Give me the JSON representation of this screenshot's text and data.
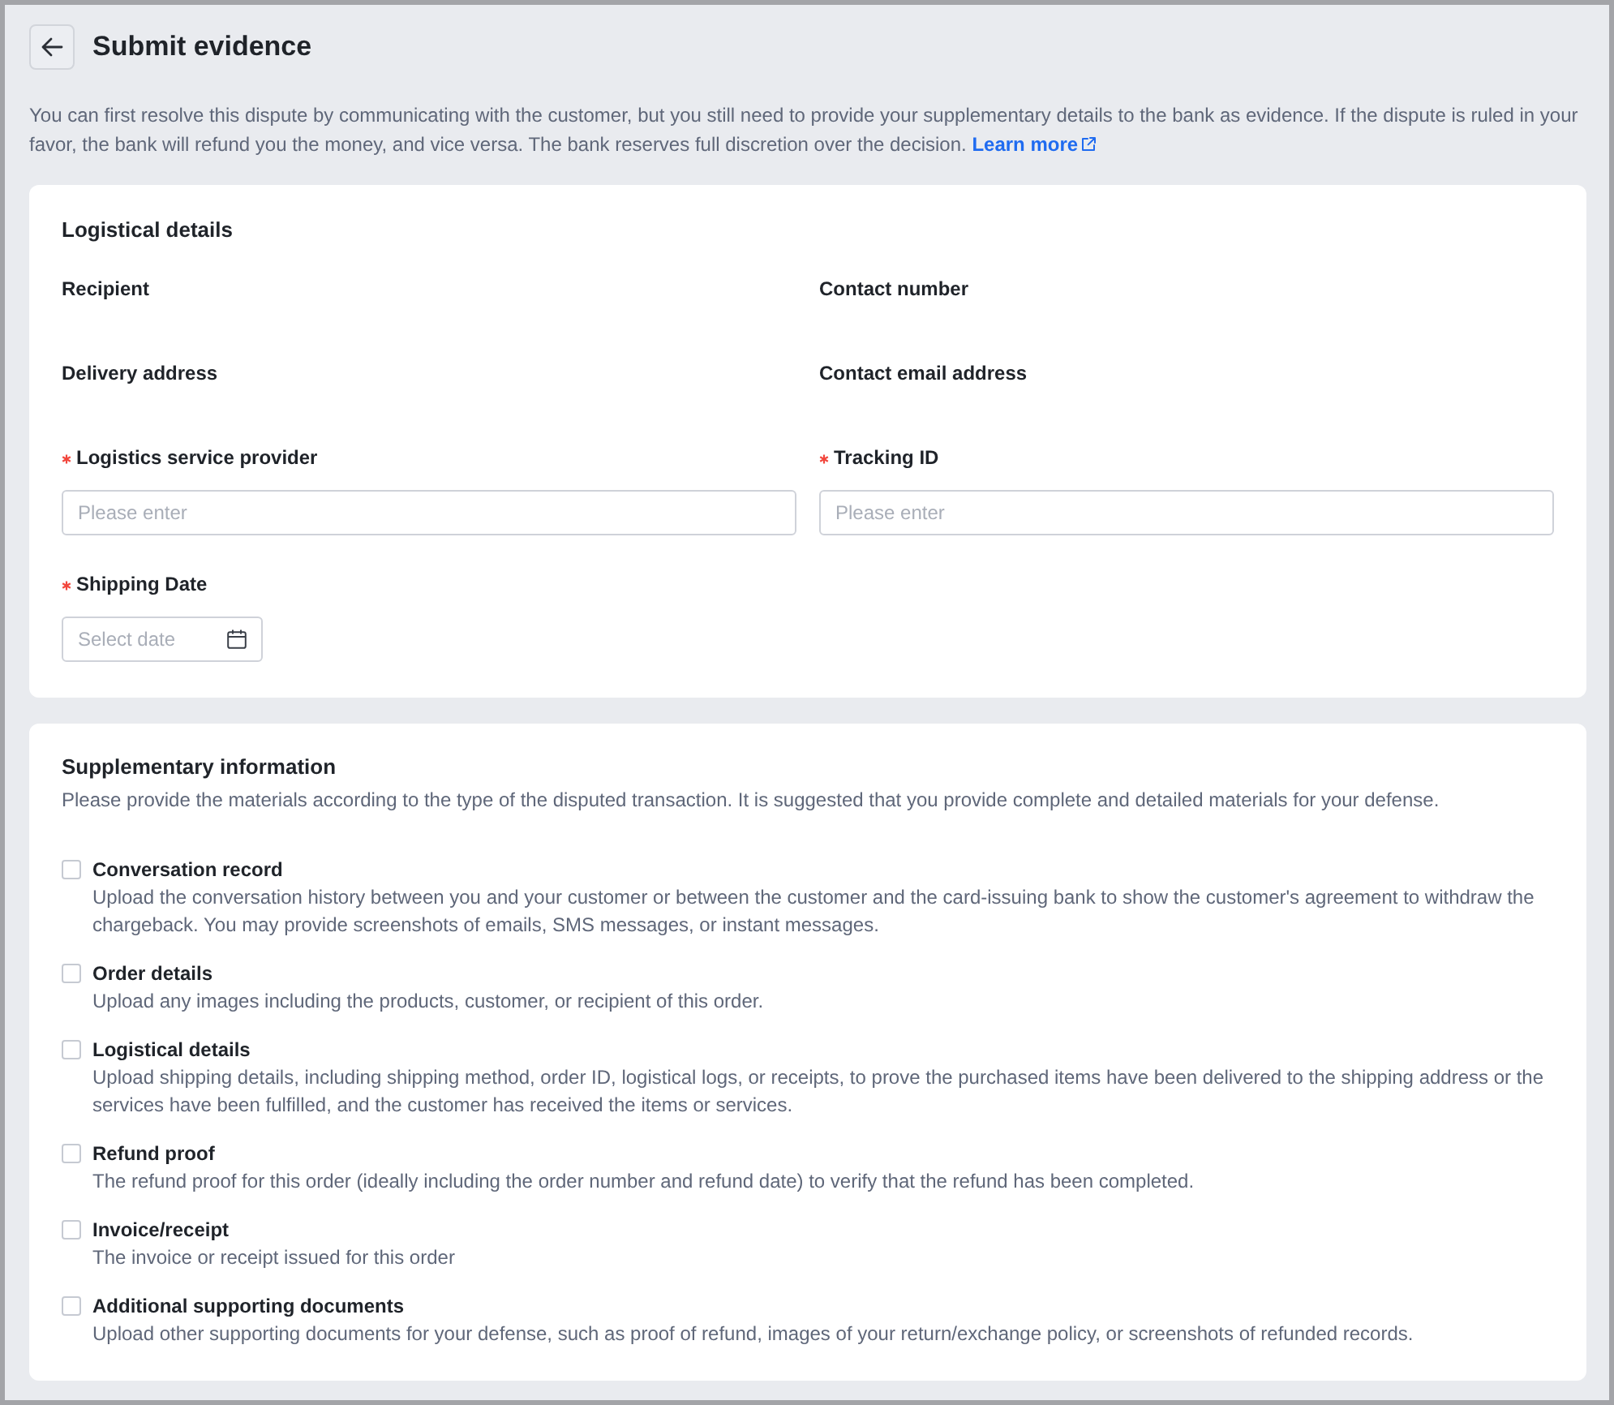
{
  "header": {
    "title": "Submit evidence"
  },
  "intro": {
    "text": "You can first resolve this dispute by communicating with the customer, but you still need to provide your supplementary details to the bank as evidence. If the dispute is ruled in your favor, the bank will refund you the money, and vice versa. The bank reserves full discretion over the decision.",
    "link": "Learn more"
  },
  "logistics": {
    "title": "Logistical details",
    "fields": [
      {
        "kind": "info",
        "label": "Recipient",
        "required": false
      },
      {
        "kind": "info",
        "label": "Contact number",
        "required": false
      },
      {
        "kind": "info",
        "label": "Delivery address",
        "required": false
      },
      {
        "kind": "info",
        "label": "Contact email address",
        "required": false
      },
      {
        "kind": "text",
        "label": "Logistics service provider",
        "required": true,
        "placeholder": "Please enter"
      },
      {
        "kind": "text",
        "label": "Tracking ID",
        "required": true,
        "placeholder": "Please enter"
      },
      {
        "kind": "date",
        "label": "Shipping Date",
        "required": true,
        "placeholder": "Select date"
      }
    ]
  },
  "supplementary": {
    "title": "Supplementary information",
    "description": "Please provide the materials according to the type of the disputed transaction. It is suggested that you provide complete and detailed materials for your defense.",
    "items": [
      {
        "label": "Conversation record",
        "description": "Upload the conversation history between you and your customer or between the customer and the card-issuing bank to show the customer's agreement to withdraw the chargeback. You may provide screenshots of emails, SMS messages, or instant messages.",
        "checked": false
      },
      {
        "label": "Order details",
        "description": "Upload any images including the products, customer, or recipient of this order.",
        "checked": false
      },
      {
        "label": "Logistical details",
        "description": "Upload shipping details, including shipping method, order ID, logistical logs, or receipts, to prove the purchased items have been delivered to the shipping address or the services have been fulfilled, and the customer has received the items or services.",
        "checked": false
      },
      {
        "label": "Refund proof",
        "description": "The refund proof for this order (ideally including the order number and refund date) to verify that the refund has been completed.",
        "checked": false
      },
      {
        "label": "Invoice/receipt",
        "description": "The invoice or receipt issued for this order",
        "checked": false
      },
      {
        "label": "Additional supporting documents",
        "description": "Upload other supporting documents for your defense, such as proof of refund, images of your return/exchange policy, or screenshots of refunded records.",
        "checked": false
      }
    ]
  }
}
